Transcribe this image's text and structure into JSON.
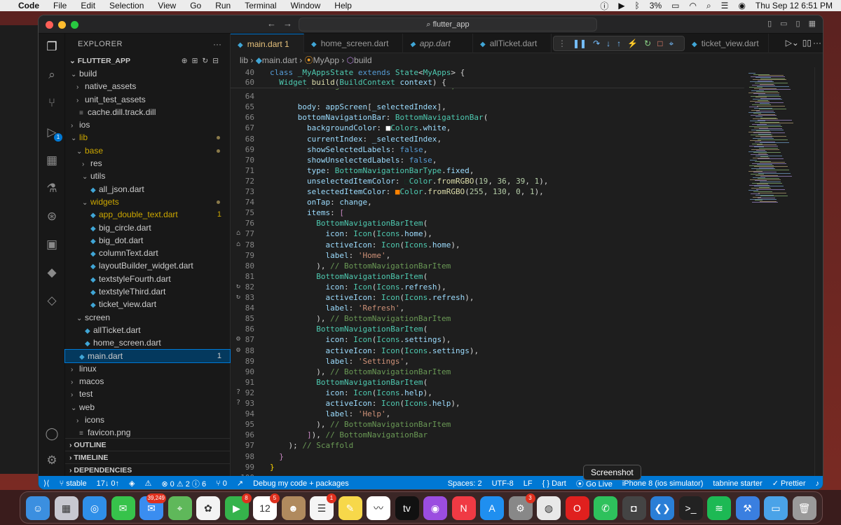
{
  "menubar": {
    "app": "Code",
    "items": [
      "File",
      "Edit",
      "Selection",
      "View",
      "Go",
      "Run",
      "Terminal",
      "Window",
      "Help"
    ],
    "battery": "3%",
    "datetime": "Thu Sep 12  6:51 PM"
  },
  "titlebar": {
    "search": "flutter_app"
  },
  "explorer": {
    "title": "EXPLORER",
    "project": "FLUTTER_APP",
    "tree": [
      {
        "label": "build",
        "indent": 1,
        "type": "folder-open"
      },
      {
        "label": "native_assets",
        "indent": 2,
        "type": "folder"
      },
      {
        "label": "unit_test_assets",
        "indent": 2,
        "type": "folder"
      },
      {
        "label": "cache.dill.track.dill",
        "indent": 2,
        "type": "file"
      },
      {
        "label": "ios",
        "indent": 1,
        "type": "folder"
      },
      {
        "label": "lib",
        "indent": 1,
        "type": "folder-open",
        "mod": true
      },
      {
        "label": "base",
        "indent": 2,
        "type": "folder-open",
        "mod": true
      },
      {
        "label": "res",
        "indent": 3,
        "type": "folder"
      },
      {
        "label": "utils",
        "indent": 3,
        "type": "folder-open"
      },
      {
        "label": "all_json.dart",
        "indent": 4,
        "type": "dart"
      },
      {
        "label": "widgets",
        "indent": 3,
        "type": "folder-open",
        "mod": true
      },
      {
        "label": "app_double_text.dart",
        "indent": 4,
        "type": "dart",
        "count": "1",
        "warn": true
      },
      {
        "label": "big_circle.dart",
        "indent": 4,
        "type": "dart"
      },
      {
        "label": "big_dot.dart",
        "indent": 4,
        "type": "dart"
      },
      {
        "label": "columnText.dart",
        "indent": 4,
        "type": "dart"
      },
      {
        "label": "layoutBuilder_widget.dart",
        "indent": 4,
        "type": "dart"
      },
      {
        "label": "textstyleFourth.dart",
        "indent": 4,
        "type": "dart"
      },
      {
        "label": "textstyleThird.dart",
        "indent": 4,
        "type": "dart"
      },
      {
        "label": "ticket_view.dart",
        "indent": 4,
        "type": "dart"
      },
      {
        "label": "screen",
        "indent": 2,
        "type": "folder-open"
      },
      {
        "label": "allTicket.dart",
        "indent": 3,
        "type": "dart"
      },
      {
        "label": "home_screen.dart",
        "indent": 3,
        "type": "dart"
      },
      {
        "label": "main.dart",
        "indent": 2,
        "type": "dart",
        "count": "1",
        "selected": true
      },
      {
        "label": "linux",
        "indent": 1,
        "type": "folder"
      },
      {
        "label": "macos",
        "indent": 1,
        "type": "folder"
      },
      {
        "label": "test",
        "indent": 1,
        "type": "folder"
      },
      {
        "label": "web",
        "indent": 1,
        "type": "folder-open"
      },
      {
        "label": "icons",
        "indent": 2,
        "type": "folder"
      },
      {
        "label": "favicon.png",
        "indent": 2,
        "type": "file"
      }
    ],
    "sections": [
      "OUTLINE",
      "TIMELINE",
      "DEPENDENCIES"
    ]
  },
  "tabs": [
    {
      "label": "main.dart 1",
      "active": true
    },
    {
      "label": "home_screen.dart"
    },
    {
      "label": "app.dart"
    },
    {
      "label": "allTicket.dart"
    },
    {
      "label": "ticket_view.dart"
    }
  ],
  "breadcrumb": [
    "lib",
    "main.dart",
    "MyApp",
    "build"
  ],
  "sticky": [
    {
      "n": "40",
      "html": "<span class='k'>class</span> <span class='t'>_MyAppsState</span> <span class='k'>extends</span> <span class='t'>State</span>&lt;<span class='t'>MyApps</span>&gt; {"
    },
    {
      "n": "60",
      "html": "  <span class='t'>Widget</span> <span class='f'>build</span>(<span class='t'>BuildContext</span> <span class='p'>context</span>) {"
    }
  ],
  "code": [
    {
      "n": "",
      "g": "",
      "html": "        <span class='c'>//backgroundColor: Colors.white,</span>"
    },
    {
      "n": "64",
      "g": "",
      "html": ""
    },
    {
      "n": "65",
      "g": "",
      "html": "      <span class='p'>body</span>: <span class='p'>appScreen</span>[<span class='p'>_selectedIndex</span>],"
    },
    {
      "n": "66",
      "g": "",
      "html": "      <span class='p'>bottomNavigationBar</span>: <span class='t'>BottomNavigationBar</span>("
    },
    {
      "n": "67",
      "g": "",
      "html": "        <span class='p'>backgroundColor</span>: <span style='color:#fff'>■</span><span class='t'>Colors</span>.<span class='p'>white</span>,"
    },
    {
      "n": "68",
      "g": "",
      "html": "        <span class='p'>currentIndex</span>: <span class='p'>_selectedIndex</span>,"
    },
    {
      "n": "69",
      "g": "",
      "html": "        <span class='p'>showSelectedLabels</span>: <span class='k'>false</span>,"
    },
    {
      "n": "70",
      "g": "",
      "html": "        <span class='p'>showUnselectedLabels</span>: <span class='k'>false</span>,"
    },
    {
      "n": "71",
      "g": "",
      "html": "        <span class='p'>type</span>: <span class='t'>BottomNavigationBarType</span>.<span class='p'>fixed</span>,"
    },
    {
      "n": "72",
      "g": "",
      "html": "        <span class='p'>unselectedItemColor</span>: <span style='color:#133627'>□</span><span class='t'>Color</span>.<span class='f'>fromRGBO</span>(<span class='n'>19</span>, <span class='n'>36</span>, <span class='n'>39</span>, <span class='n'>1</span>),"
    },
    {
      "n": "73",
      "g": "",
      "html": "        <span class='p'>selectedItemColor</span>: <span style='color:#ff8200'>■</span><span class='t'>Color</span>.<span class='f'>fromRGBO</span>(<span class='n'>255</span>, <span class='n'>130</span>, <span class='n'>0</span>, <span class='n'>1</span>),"
    },
    {
      "n": "74",
      "g": "",
      "html": "        <span class='p'>onTap</span>: <span class='p'>change</span>,"
    },
    {
      "n": "75",
      "g": "",
      "html": "        <span class='p'>items</span>: <span class='pu'>[</span>"
    },
    {
      "n": "76",
      "g": "",
      "html": "          <span class='t'>BottomNavigationBarItem</span>("
    },
    {
      "n": "77",
      "g": "⌂",
      "html": "            <span class='p'>icon</span>: <span class='t'>Icon</span>(<span class='t'>Icons</span>.<span class='p'>home</span>),"
    },
    {
      "n": "78",
      "g": "⌂",
      "html": "            <span class='p'>activeIcon</span>: <span class='t'>Icon</span>(<span class='t'>Icons</span>.<span class='p'>home</span>),"
    },
    {
      "n": "79",
      "g": "",
      "html": "            <span class='p'>label</span>: <span class='s'>'Home'</span>,"
    },
    {
      "n": "80",
      "g": "",
      "html": "          ), <span class='c'>// BottomNavigationBarItem</span>"
    },
    {
      "n": "81",
      "g": "",
      "html": "          <span class='t'>BottomNavigationBarItem</span>("
    },
    {
      "n": "82",
      "g": "↻",
      "html": "            <span class='p'>icon</span>: <span class='t'>Icon</span>(<span class='t'>Icons</span>.<span class='p'>refresh</span>),"
    },
    {
      "n": "83",
      "g": "↻",
      "html": "            <span class='p'>activeIcon</span>: <span class='t'>Icon</span>(<span class='t'>Icons</span>.<span class='p'>refresh</span>),"
    },
    {
      "n": "84",
      "g": "",
      "html": "            <span class='p'>label</span>: <span class='s'>'Refresh'</span>,"
    },
    {
      "n": "85",
      "g": "",
      "html": "          ), <span class='c'>// BottomNavigationBarItem</span>"
    },
    {
      "n": "86",
      "g": "",
      "html": "          <span class='t'>BottomNavigationBarItem</span>("
    },
    {
      "n": "87",
      "g": "⚙",
      "html": "            <span class='p'>icon</span>: <span class='t'>Icon</span>(<span class='t'>Icons</span>.<span class='p'>settings</span>),"
    },
    {
      "n": "88",
      "g": "⚙",
      "html": "            <span class='p'>activeIcon</span>: <span class='t'>Icon</span>(<span class='t'>Icons</span>.<span class='p'>settings</span>),"
    },
    {
      "n": "89",
      "g": "",
      "html": "            <span class='p'>label</span>: <span class='s'>'Settings'</span>,"
    },
    {
      "n": "90",
      "g": "",
      "html": "          ), <span class='c'>// BottomNavigationBarItem</span>"
    },
    {
      "n": "91",
      "g": "",
      "html": "          <span class='t'>BottomNavigationBarItem</span>("
    },
    {
      "n": "92",
      "g": "?",
      "html": "            <span class='p'>icon</span>: <span class='t'>Icon</span>(<span class='t'>Icons</span>.<span class='p'>help</span>),"
    },
    {
      "n": "93",
      "g": "?",
      "html": "            <span class='p'>activeIcon</span>: <span class='t'>Icon</span>(<span class='t'>Icons</span>.<span class='p'>help</span>),"
    },
    {
      "n": "94",
      "g": "",
      "html": "            <span class='p'>label</span>: <span class='s'>'Help'</span>,"
    },
    {
      "n": "95",
      "g": "",
      "html": "          ), <span class='c'>// BottomNavigationBarItem</span>"
    },
    {
      "n": "96",
      "g": "",
      "html": "        <span class='pu'>]</span>), <span class='c'>// BottomNavigationBar</span>"
    },
    {
      "n": "97",
      "g": "",
      "html": "    ); <span class='c'>// Scaffold</span>"
    },
    {
      "n": "98",
      "g": "",
      "html": "  <span class='pu'>}</span>"
    },
    {
      "n": "99",
      "g": "",
      "html": "<span class='br'>}</span>"
    },
    {
      "n": "100",
      "g": "",
      "html": ""
    }
  ],
  "status": {
    "branch": "stable",
    "sync": "17↓ 0↑",
    "problems": "⊗ 0 ⚠ 2 ⓘ 6",
    "ports": "⑂ 0",
    "debug": "Debug my code + packages",
    "spaces": "Spaces: 2",
    "encoding": "UTF-8",
    "eol": "LF",
    "lang": "{ } Dart",
    "golive": "Go Live",
    "device": "iPhone 8 (ios simulator)",
    "tabnine": "tabnine starter",
    "prettier": "Prettier"
  },
  "tooltip": "Screenshot",
  "dock": [
    {
      "name": "Finder",
      "color": "#3b8fe0",
      "g": "☺"
    },
    {
      "name": "Launchpad",
      "color": "#c8c8d0",
      "g": "▦"
    },
    {
      "name": "Safari",
      "color": "#2f8fe8",
      "g": "◎"
    },
    {
      "name": "Messages",
      "color": "#37c34b",
      "g": "✉"
    },
    {
      "name": "Mail",
      "color": "#3a8df0",
      "g": "✉",
      "badge": "39,249"
    },
    {
      "name": "Maps",
      "color": "#5fb85a",
      "g": "⌖"
    },
    {
      "name": "Photos",
      "color": "#f3f3f3",
      "g": "✿"
    },
    {
      "name": "FaceTime",
      "color": "#35b34b",
      "g": "▶",
      "badge": "8"
    },
    {
      "name": "Calendar",
      "color": "#ffffff",
      "g": "12",
      "badge": "5"
    },
    {
      "name": "Contacts",
      "color": "#b08a5e",
      "g": "☻"
    },
    {
      "name": "Reminders",
      "color": "#f5f5f5",
      "g": "☰",
      "badge": "1"
    },
    {
      "name": "Notes",
      "color": "#f7d84a",
      "g": "✎"
    },
    {
      "name": "Freeform",
      "color": "#ffffff",
      "g": "〰"
    },
    {
      "name": "TV",
      "color": "#111111",
      "g": "tv"
    },
    {
      "name": "Podcasts",
      "color": "#9b4de0",
      "g": "◉"
    },
    {
      "name": "News",
      "color": "#f03a44",
      "g": "N"
    },
    {
      "name": "App Store",
      "color": "#1f8ff0",
      "g": "A"
    },
    {
      "name": "System Settings",
      "color": "#888888",
      "g": "⚙",
      "badge": "3"
    },
    {
      "name": "Chrome",
      "color": "#e8e8e8",
      "g": "◍"
    },
    {
      "name": "Opera",
      "color": "#e0201e",
      "g": "O"
    },
    {
      "name": "WhatsApp",
      "color": "#2ec15c",
      "g": "✆"
    },
    {
      "name": "Screenshot",
      "color": "#444444",
      "g": "◘"
    },
    {
      "name": "VS Code",
      "color": "#2a7ed6",
      "g": "❮❯"
    },
    {
      "name": "Terminal",
      "color": "#222222",
      "g": ">_"
    },
    {
      "name": "Spotify",
      "color": "#1db954",
      "g": "≋"
    },
    {
      "name": "Xcode",
      "color": "#3a7fe0",
      "g": "⚒"
    },
    {
      "name": "Downloads",
      "color": "#4aa3e8",
      "g": "▭"
    },
    {
      "name": "Trash",
      "color": "#9a9a9a",
      "g": "🗑"
    }
  ]
}
